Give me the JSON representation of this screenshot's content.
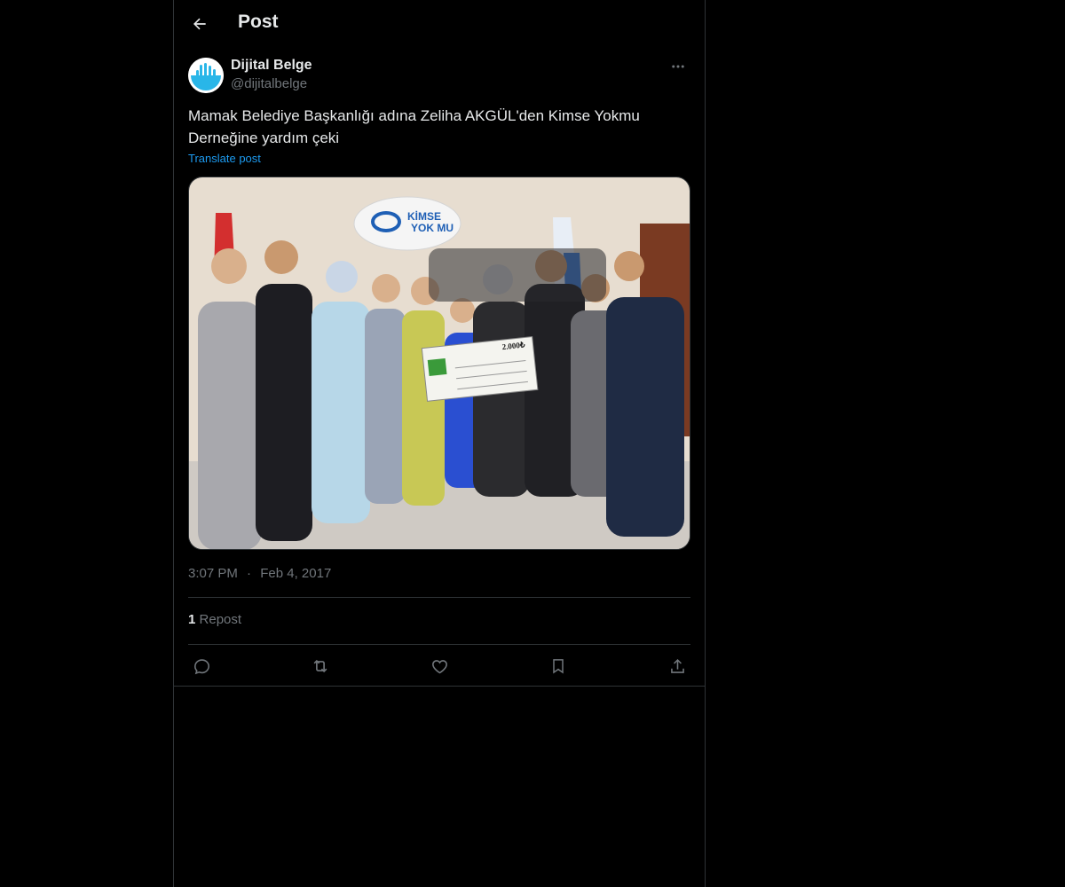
{
  "header": {
    "title": "Post"
  },
  "author": {
    "display_name": "Dijital Belge",
    "handle": "@dijitalbelge"
  },
  "post": {
    "text": "Mamak Belediye Başkanlığı adına Zeliha AKGÜL'den Kimse Yokmu Derneğine yardım çeki",
    "translate_label": "Translate post",
    "time": "3:07 PM",
    "separator": "·",
    "date": "Feb 4, 2017"
  },
  "stats": {
    "repost_count": "1",
    "repost_label": "Repost"
  },
  "photo": {
    "banner_line1": "KİMSE",
    "banner_line2": "YOK MU",
    "check_amount": "2.000₺"
  },
  "icons": {
    "back": "arrow-left-icon",
    "more": "more-horizontal-icon",
    "reply": "reply-icon",
    "repost": "repost-icon",
    "like": "heart-icon",
    "bookmark": "bookmark-icon",
    "share": "share-icon"
  },
  "colors": {
    "background": "#000000",
    "text": "#e7e9ea",
    "muted": "#71767b",
    "link": "#1d9bf0",
    "border": "#2f3336"
  }
}
